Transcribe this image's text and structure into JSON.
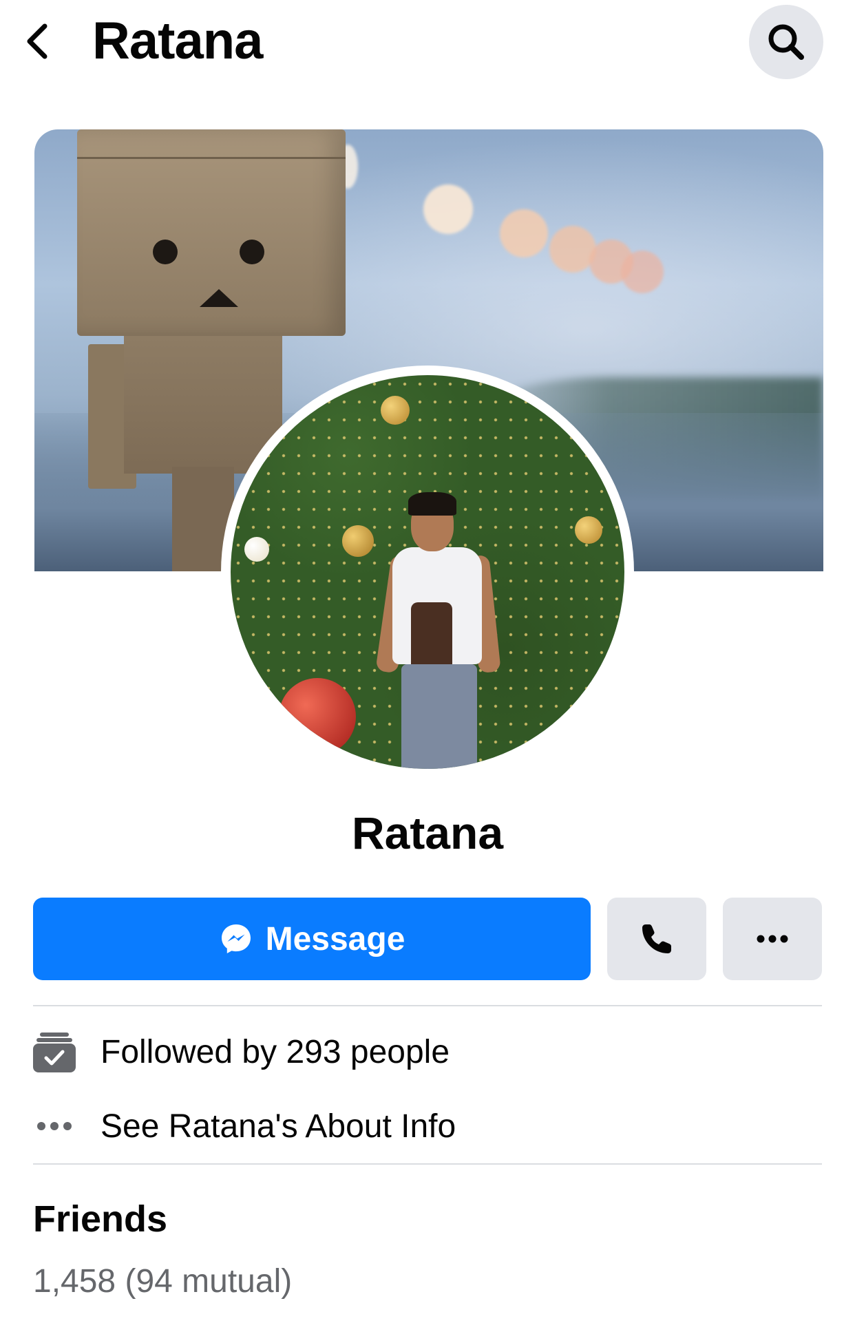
{
  "header": {
    "title": "Ratana"
  },
  "profile": {
    "name": "Ratana"
  },
  "actions": {
    "message_label": "Message"
  },
  "info": {
    "followers_text": "Followed by 293 people",
    "about_text": "See Ratana's About Info"
  },
  "friends": {
    "title": "Friends",
    "count_text": "1,458 (94 mutual)"
  },
  "icons": {
    "back": "chevron-left-icon",
    "search": "search-icon",
    "messenger": "messenger-icon",
    "call": "phone-icon",
    "more": "more-horizontal-icon",
    "followers": "rss-check-icon",
    "about": "ellipsis-icon"
  },
  "colors": {
    "primary": "#0a7cff",
    "secondary_button": "#e4e6eb",
    "muted_text": "#65676b",
    "divider": "#dadde1"
  }
}
